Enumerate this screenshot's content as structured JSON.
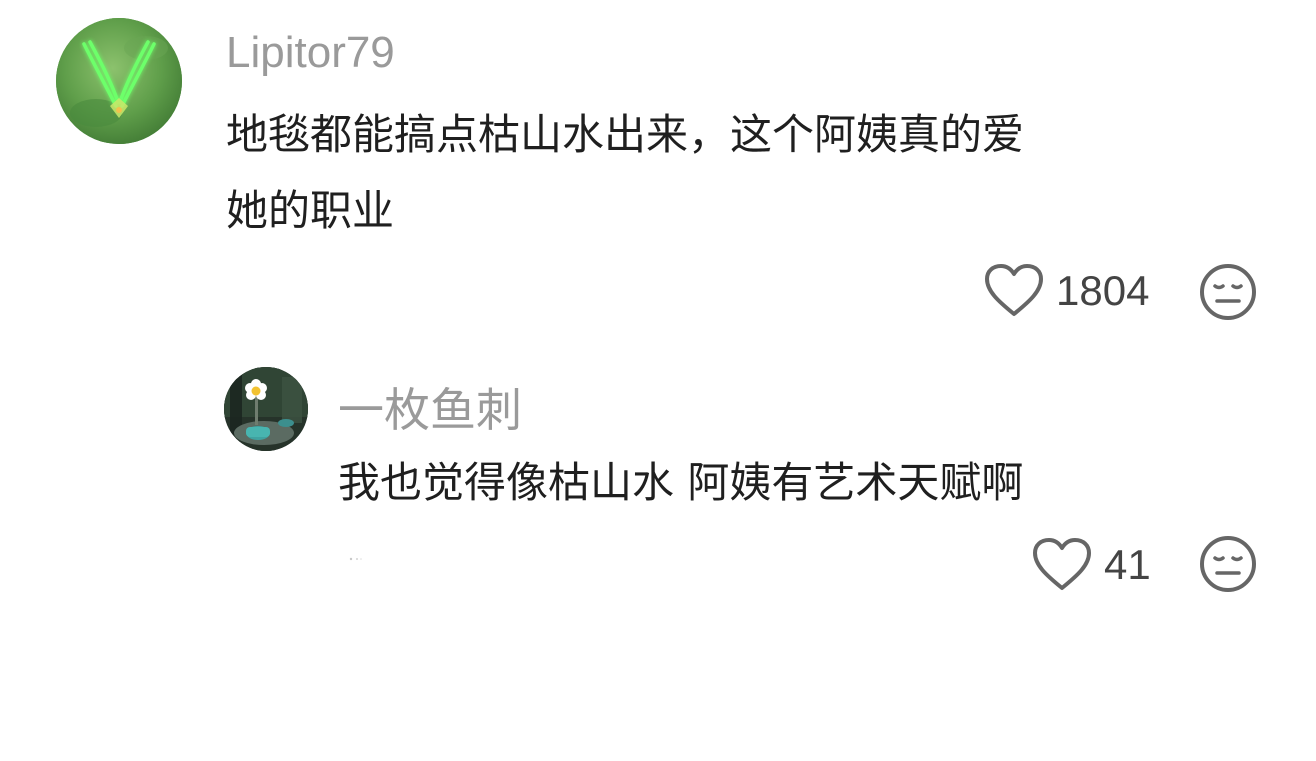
{
  "comments": [
    {
      "username": "Lipitor79",
      "text_line1": "地毯都能搞点枯山水出来，这个阿姨真的爱",
      "text_line2": "她的职业",
      "likes": "1804",
      "avatar": "green-antenna-avatar"
    }
  ],
  "replies": [
    {
      "username": "一枚鱼刺",
      "text": "我也觉得像枯山水 阿姨有艺术天赋啊",
      "likes": "41",
      "avatar": "flower-garden-avatar"
    }
  ],
  "icons": {
    "like": "heart-outline-icon",
    "dislike": "neutral-face-icon"
  },
  "colors": {
    "username": "#9a9a9a",
    "text": "#1f1f1f",
    "icon": "#666666"
  }
}
